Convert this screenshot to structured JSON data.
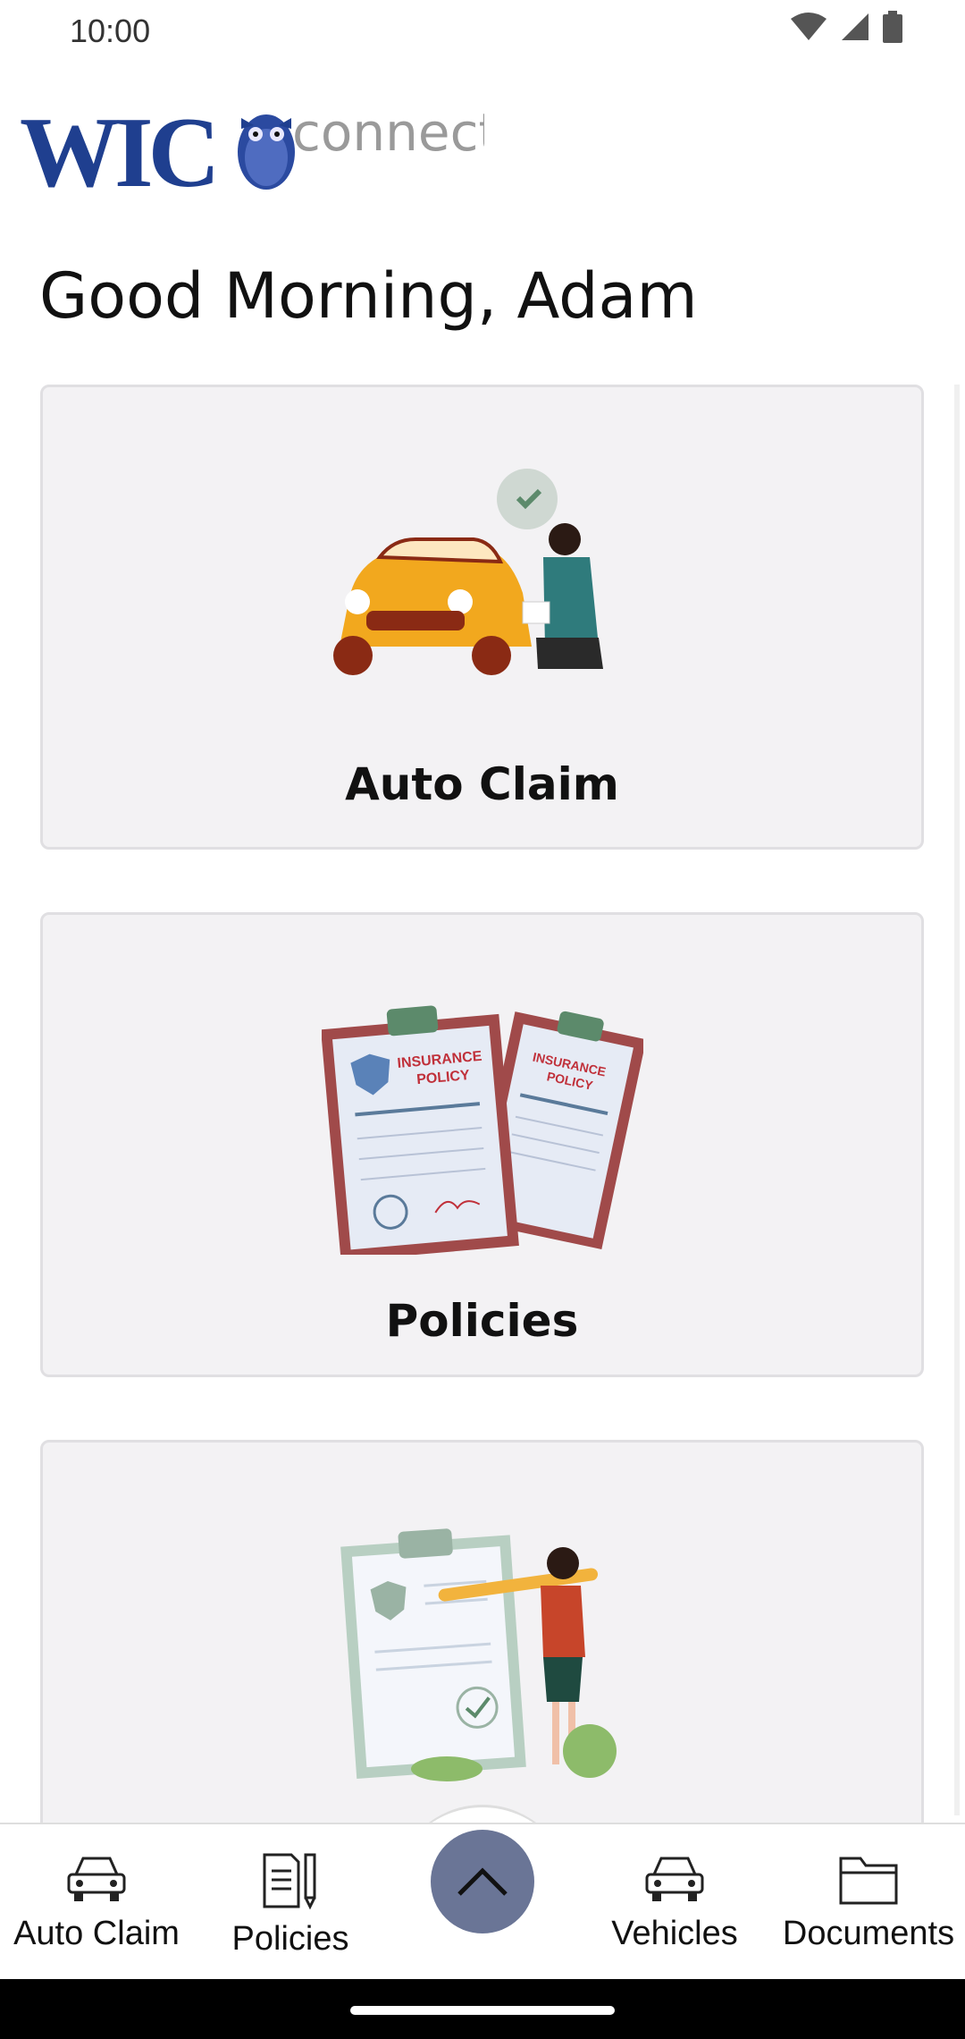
{
  "status_bar": {
    "time": "10:00"
  },
  "header": {
    "logo_text": "WIC",
    "logo_subtext": "connect"
  },
  "greeting": "Good Morning, Adam",
  "cards": [
    {
      "label": "Auto Claim",
      "illustration": "car-claim-illustration"
    },
    {
      "label": "Policies",
      "illustration": "insurance-policy-illustration"
    },
    {
      "label": "",
      "illustration": "checklist-illustration"
    }
  ],
  "bottom_nav": {
    "items": [
      {
        "label": "Auto Claim",
        "icon": "car-icon"
      },
      {
        "label": "Policies",
        "icon": "document-pen-icon"
      },
      {
        "label": "Vehicles",
        "icon": "car-icon"
      },
      {
        "label": "Documents",
        "icon": "folder-icon"
      }
    ],
    "fab_icon": "chevron-up-icon"
  },
  "colors": {
    "fab": "#6a7596",
    "logo_blue": "#1f3f8f",
    "card_bg": "#f3f2f4"
  }
}
